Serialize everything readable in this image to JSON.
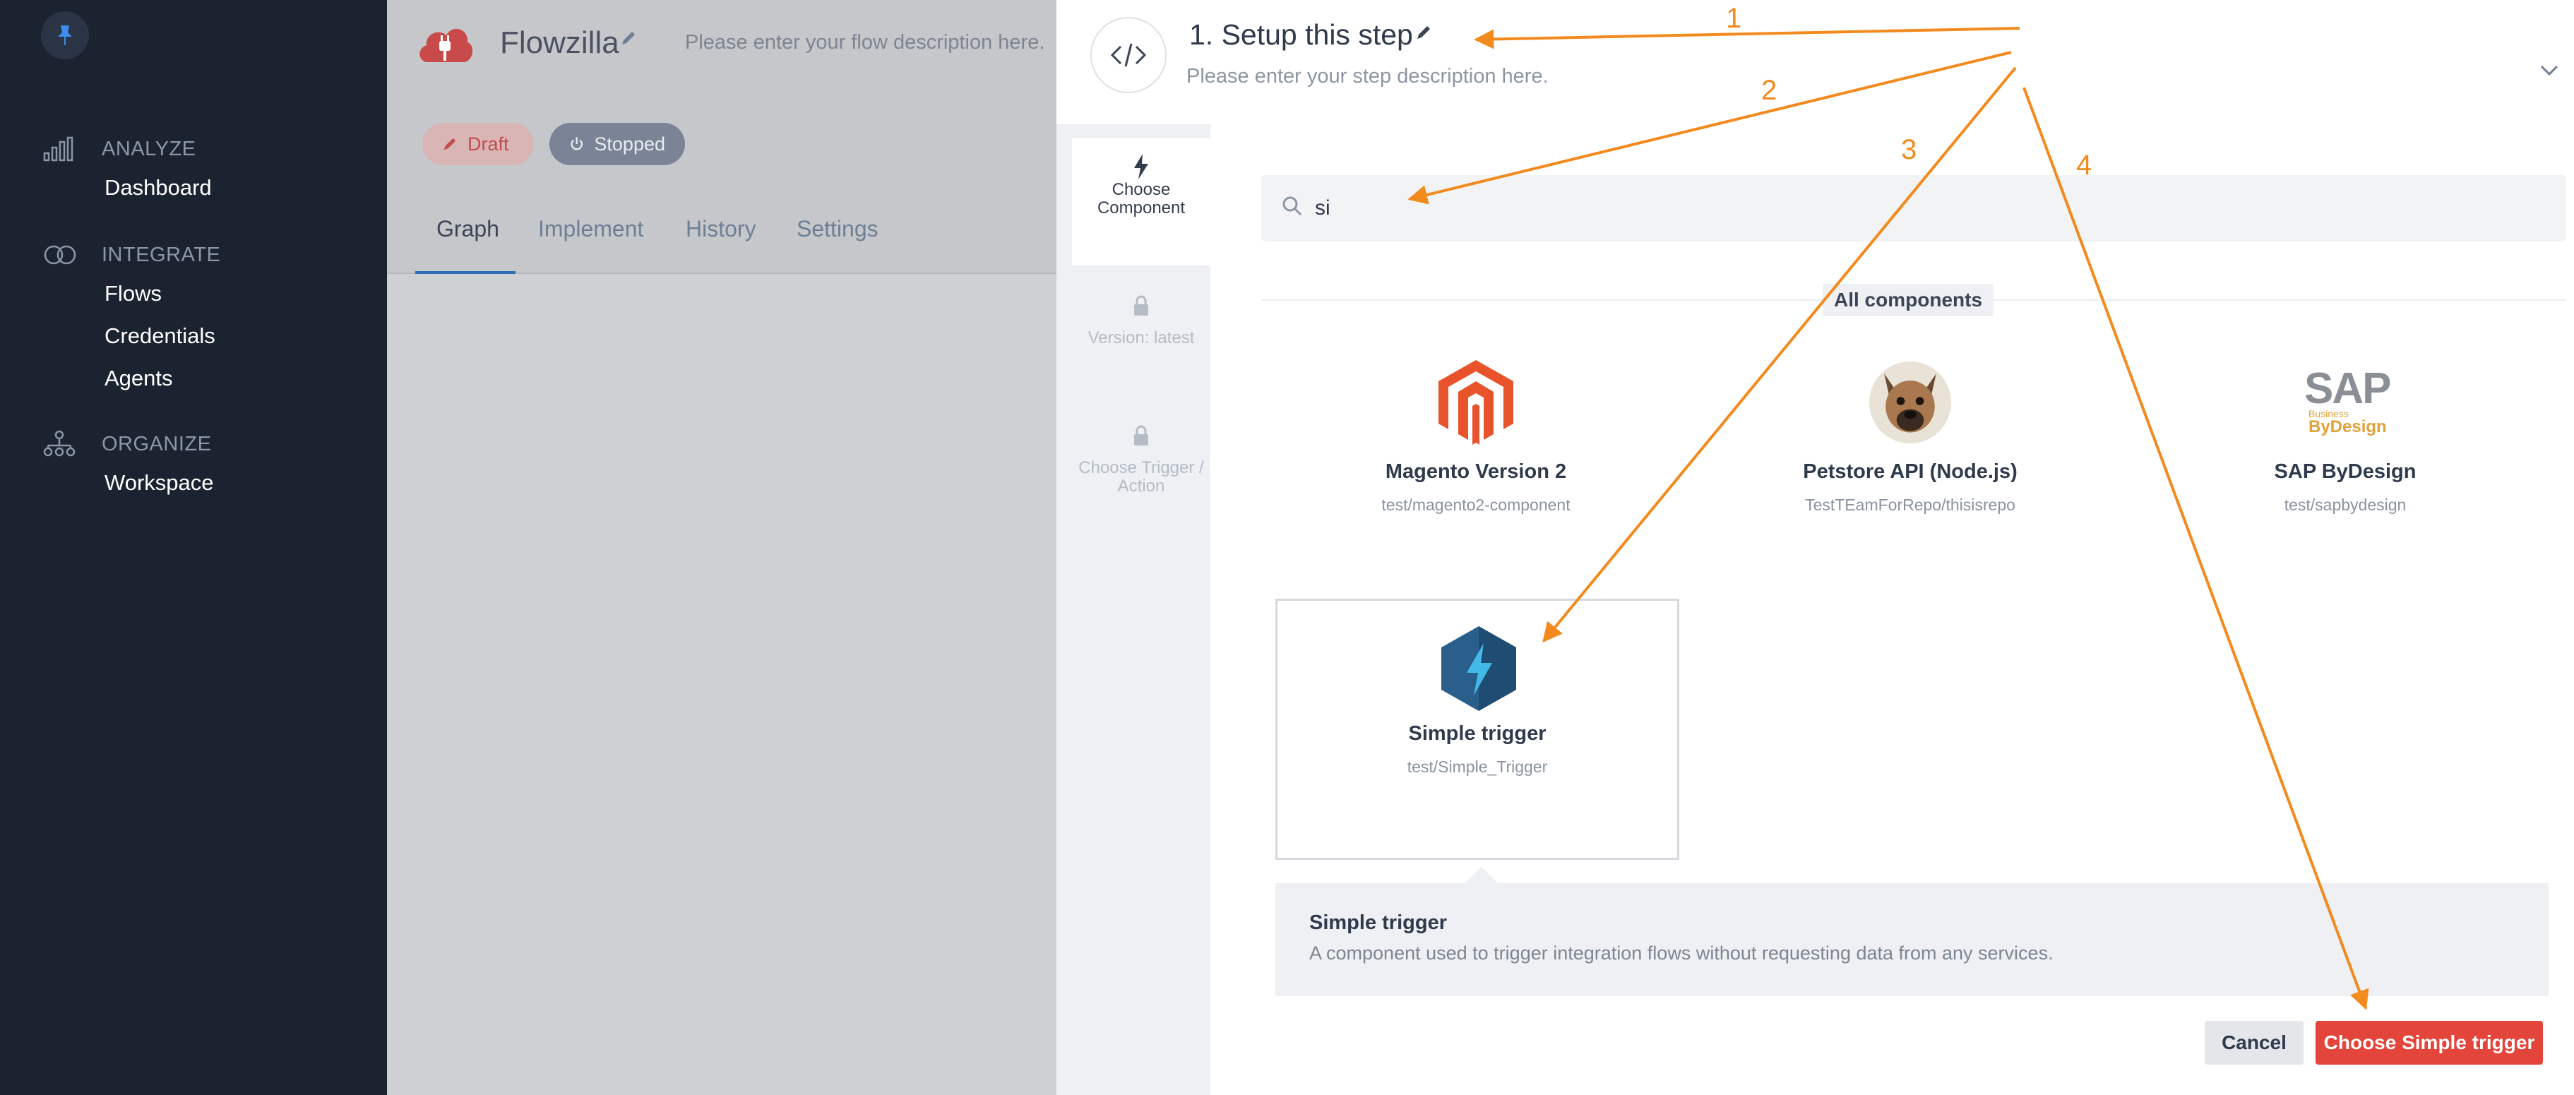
{
  "sidebar": {
    "pin_icon": "pin-icon",
    "groups": [
      {
        "label": "ANALYZE",
        "icon": "bar-chart-icon",
        "items": [
          "Dashboard"
        ]
      },
      {
        "label": "INTEGRATE",
        "icon": "integrate-rings-icon",
        "items": [
          "Flows",
          "Credentials",
          "Agents"
        ]
      },
      {
        "label": "ORGANIZE",
        "icon": "org-chart-icon",
        "items": [
          "Workspace"
        ]
      }
    ]
  },
  "flow": {
    "name": "Flowzilla",
    "description_placeholder": "Please enter your flow description here.",
    "status": {
      "draft": "Draft",
      "stopped": "Stopped"
    },
    "tabs": [
      "Graph",
      "Implement",
      "History",
      "Settings"
    ],
    "active_tab": "Graph"
  },
  "step": {
    "title": "1. Setup this step",
    "description_placeholder": "Please enter your step description here.",
    "nav": {
      "choose_component": "Choose Component",
      "version": "Version: latest",
      "choose_trigger": "Choose Trigger / Action"
    },
    "search": {
      "value": "si"
    },
    "section_label": "All components",
    "components": [
      {
        "name": "Magento Version 2",
        "repo": "test/magento2-component",
        "icon": "magento-logo-icon"
      },
      {
        "name": "Petstore API (Node.js)",
        "repo": "TestTEamForRepo/thisisrepo",
        "icon": "french-bulldog-avatar-icon"
      },
      {
        "name": "SAP ByDesign",
        "repo": "test/sapbydesign",
        "icon": "sap-bydesign-logo-icon",
        "logo_text": "SAP",
        "logo_subtext_1": "Business",
        "logo_subtext_2": "ByDesign"
      },
      {
        "name": "Simple trigger",
        "repo": "test/Simple_Trigger",
        "icon": "lightning-hexagon-icon",
        "selected": true
      }
    ],
    "detail": {
      "title": "Simple trigger",
      "text": "A component used to trigger integration flows without requesting data from any services."
    },
    "buttons": {
      "cancel": "Cancel",
      "choose": "Choose Simple trigger"
    }
  },
  "annotations": {
    "color": "#f28a1e",
    "labels": [
      "1",
      "2",
      "3",
      "4"
    ]
  },
  "colors": {
    "sidebar_bg": "#1c2330",
    "primary_button": "#e4453a",
    "active_tab": "#2e6fb8"
  }
}
